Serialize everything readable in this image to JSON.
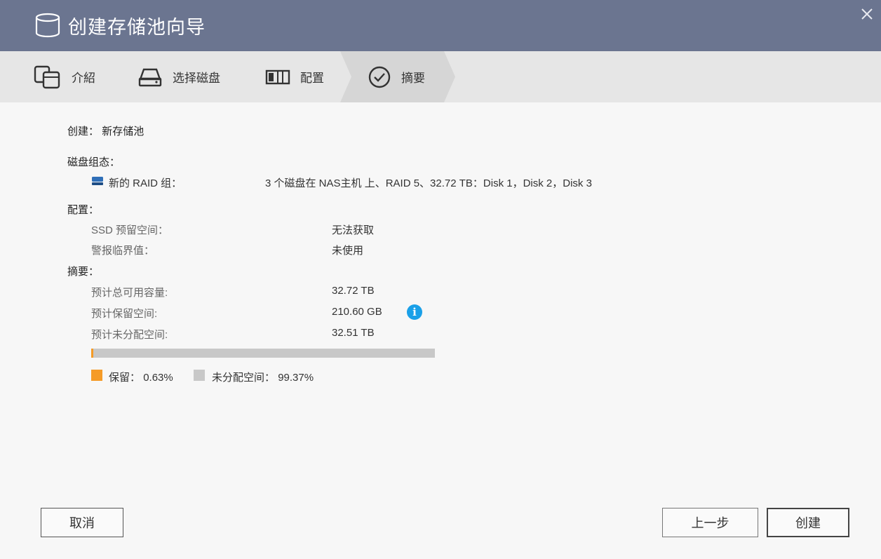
{
  "window": {
    "title": "创建存储池向导",
    "icons": {
      "title": "database-icon",
      "close": "close-icon"
    }
  },
  "steps": [
    {
      "label": "介紹",
      "icon": "stacked-disks-icon",
      "active": false
    },
    {
      "label": "选择磁盘",
      "icon": "hard-drive-icon",
      "active": false
    },
    {
      "label": "配置",
      "icon": "raid-config-icon",
      "active": false
    },
    {
      "label": "摘要",
      "icon": "check-circle-icon",
      "active": true
    }
  ],
  "create": {
    "label": "创建：",
    "value": "新存储池"
  },
  "disk_config": {
    "heading": "磁盘组态：",
    "raid_icon": "drive-icon",
    "raid_label": "新的 RAID 组：",
    "raid_value": "3 个磁盘在 NAS主机 上、RAID 5、32.72 TB：Disk 1，Disk 2，Disk 3"
  },
  "config": {
    "heading": "配置：",
    "ssd_label": "SSD 预留空间：",
    "ssd_value": "无法获取",
    "alert_label": "警报临界值：",
    "alert_value": "未使用"
  },
  "summary": {
    "heading": "摘要：",
    "total_label": "预计总可用容量:",
    "total_value": "32.72 TB",
    "reserved_label": "预计保留空间:",
    "reserved_value": "210.60 GB",
    "unallocated_label": "预计未分配空间:",
    "unallocated_value": "32.51 TB",
    "info_icon": "info-icon",
    "reserved_fraction": 0.0063
  },
  "legend": {
    "reserved_label": "保留：",
    "reserved_pct": "0.63%",
    "reserved_color": "#f59b27",
    "unallocated_label": "未分配空间：",
    "unallocated_pct": "99.37%",
    "unallocated_color": "#c8c8c8"
  },
  "buttons": {
    "cancel": "取消",
    "prev": "上一步",
    "create": "创建"
  }
}
